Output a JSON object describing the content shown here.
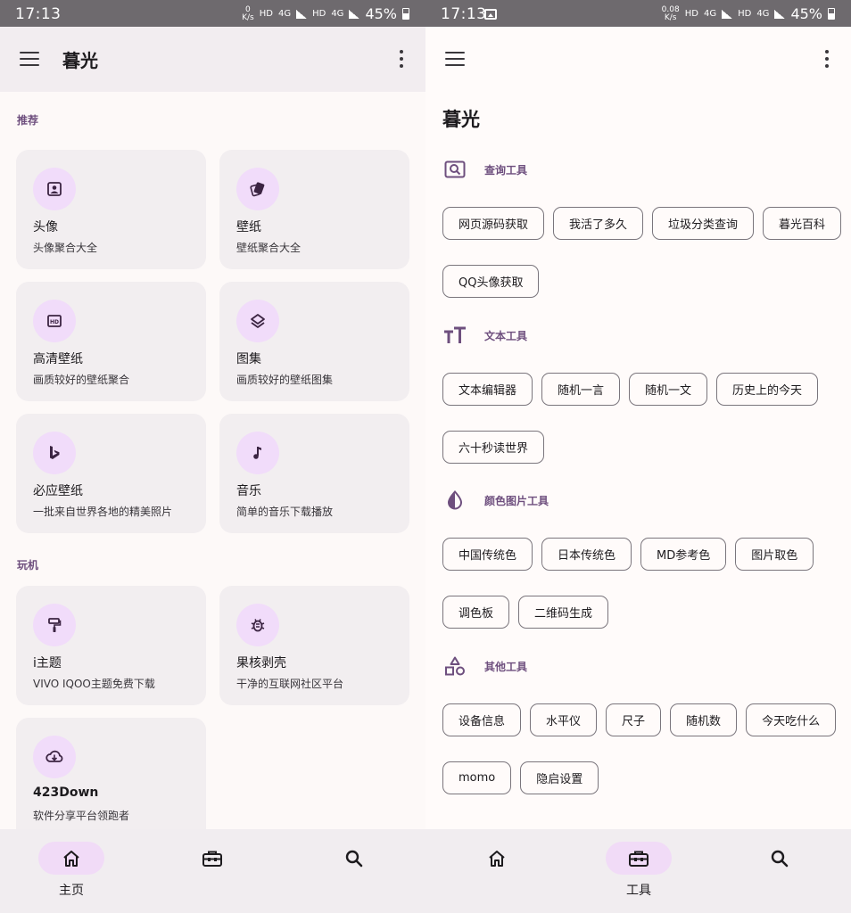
{
  "left": {
    "status": {
      "time": "17:13",
      "speed_value": "0",
      "speed_unit": "K/s",
      "hd1": "HD",
      "net1": "4G",
      "hd2": "HD",
      "net2": "4G",
      "battery": "45%"
    },
    "appbar": {
      "title": "暮光"
    },
    "sections": [
      {
        "label": "推荐"
      },
      {
        "label": "玩机"
      }
    ],
    "cards": [
      {
        "title": "头像",
        "subtitle": "头像聚合大全",
        "icon": "portrait-icon"
      },
      {
        "title": "壁纸",
        "subtitle": "壁纸聚合大全",
        "icon": "wallpaper-icon"
      },
      {
        "title": "高清壁纸",
        "subtitle": "画质较好的壁纸聚合",
        "icon": "hd-icon"
      },
      {
        "title": "图集",
        "subtitle": "画质较好的壁纸图集",
        "icon": "layers-icon"
      },
      {
        "title": "必应壁纸",
        "subtitle": "一批来自世界各地的精美照片",
        "icon": "bing-icon"
      },
      {
        "title": "音乐",
        "subtitle": "简单的音乐下载播放",
        "icon": "music-note-icon"
      },
      {
        "title": "i主题",
        "subtitle": "VIVO IQOO主题免费下载",
        "icon": "paint-roller-icon"
      },
      {
        "title": "果核剥壳",
        "subtitle": "干净的互联网社区平台",
        "icon": "bug-icon"
      },
      {
        "title": "423Down",
        "subtitle": "软件分享平台领跑者",
        "icon": "cloud-download-icon"
      }
    ],
    "nav": {
      "home": "主页"
    }
  },
  "right": {
    "status": {
      "time": "17:13",
      "speed_value": "0.08",
      "speed_unit": "K/s",
      "hd1": "HD",
      "net1": "4G",
      "hd2": "HD",
      "net2": "4G",
      "battery": "45%"
    },
    "heading": "暮光",
    "groups": [
      {
        "title": "查询工具",
        "icon": "search-box-icon",
        "chips": [
          [
            "网页源码获取",
            "我活了多久",
            "垃圾分类查询",
            "暮光百科"
          ],
          [
            "QQ头像获取"
          ]
        ]
      },
      {
        "title": "文本工具",
        "icon": "text-size-icon",
        "chips": [
          [
            "文本编辑器",
            "随机一言",
            "随机一文",
            "历史上的今天"
          ],
          [
            "六十秒读世界"
          ]
        ]
      },
      {
        "title": "颜色图片工具",
        "icon": "contrast-drop-icon",
        "chips": [
          [
            "中国传统色",
            "日本传统色",
            "MD参考色",
            "图片取色"
          ],
          [
            "调色板",
            "二维码生成"
          ]
        ]
      },
      {
        "title": "其他工具",
        "icon": "shapes-icon",
        "chips": [
          [
            "设备信息",
            "水平仪",
            "尺子",
            "随机数",
            "今天吃什么"
          ],
          [
            "momo",
            "隐启设置"
          ]
        ]
      }
    ],
    "nav": {
      "tools": "工具"
    }
  },
  "colors": {
    "accent": "#6e4f7e",
    "card_bg": "#f2eef0",
    "icon_bg": "#f1dcfa",
    "nav_active": "#f1dbf7"
  }
}
